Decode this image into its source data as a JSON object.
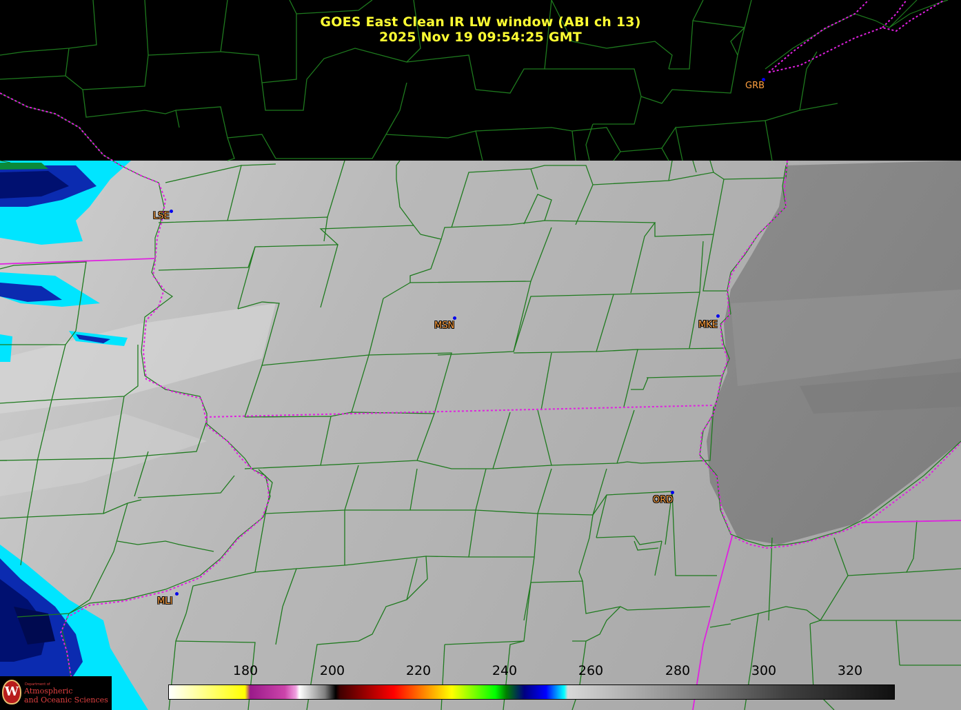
{
  "title": {
    "line1": "GOES East Clean IR LW window (ABI ch 13)",
    "line2": "2025 Nov 19  09:54:25 GMT"
  },
  "cities": [
    {
      "code": "GRB"
    },
    {
      "code": "LSE"
    },
    {
      "code": "MSN"
    },
    {
      "code": "MKE"
    },
    {
      "code": "ORD"
    },
    {
      "code": "MLI"
    }
  ],
  "colorbar": {
    "ticks": [
      "180",
      "200",
      "220",
      "240",
      "260",
      "280",
      "300",
      "320"
    ],
    "units": "",
    "colors": {
      "yellow": "#ffff00",
      "magenta": "#cc44aa",
      "red": "#ff0000",
      "green": "#00ff00",
      "navy": "#000080",
      "cyan": "#00ffff",
      "gray_light": "#d8d8d8",
      "gray_dark": "#101010"
    }
  },
  "logo": {
    "dept": "Department of",
    "line1": "Atmospheric",
    "line2": "and Oceanic Sciences"
  },
  "colors": {
    "county_lines": "#1e7a1e",
    "state_lines": "#e020e0",
    "title_text": "#ffff33",
    "city_text": "#ffa040",
    "city_marker": "#0000ee"
  }
}
